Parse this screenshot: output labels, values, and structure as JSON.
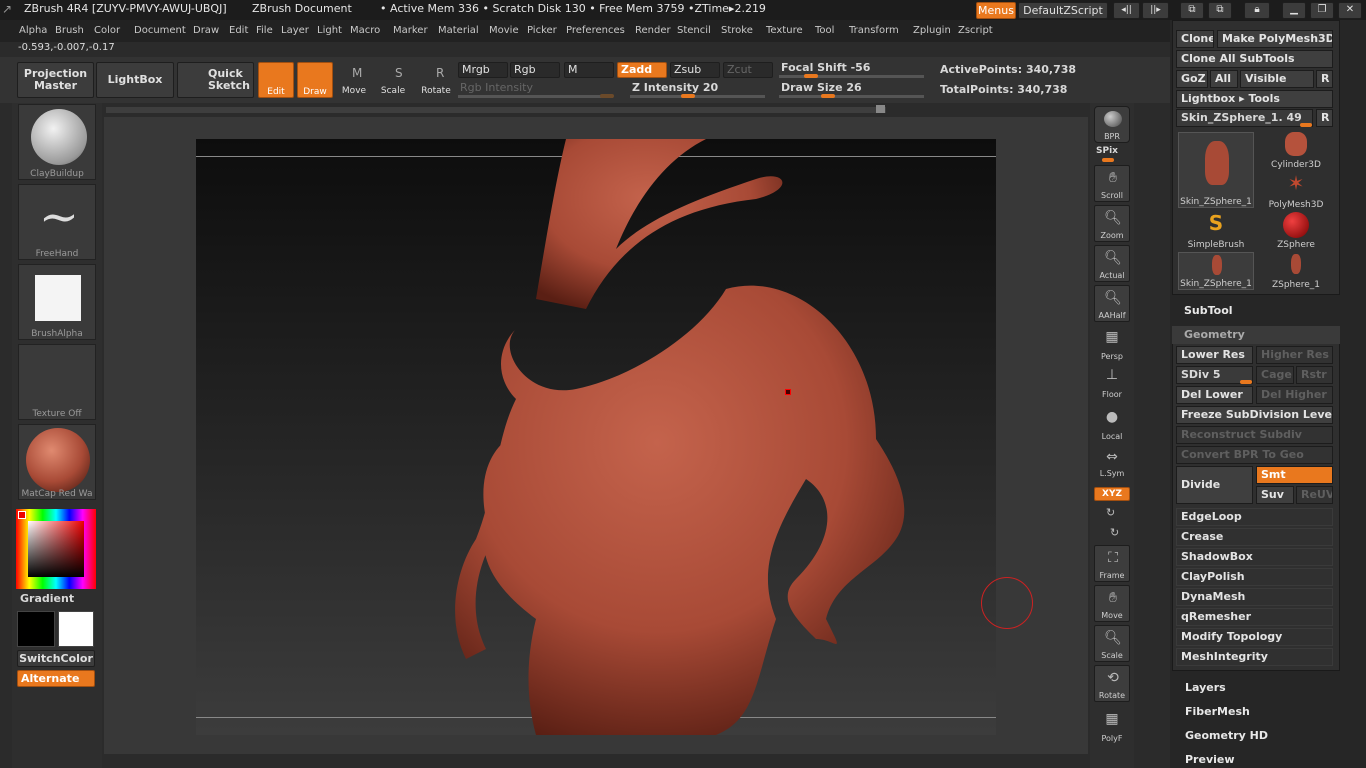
{
  "titlebar": {
    "app": "ZBrush 4R4 [ZUYV-PMVY-AWUJ-UBQJ]",
    "document": "ZBrush Document",
    "stats": "• Active Mem 336 • Scratch Disk 130 • Free Mem 3759 •ZTime▸2.219",
    "menus_btn": "Menus",
    "script_btn": "DefaultZScript"
  },
  "menubar": [
    "Alpha",
    "Brush",
    "Color",
    "Document",
    "Draw",
    "Edit",
    "File",
    "Layer",
    "Light",
    "Macro",
    "Marker",
    "Material",
    "Movie",
    "Picker",
    "Preferences",
    "Render",
    "Stencil",
    "Stroke",
    "Texture",
    "Tool",
    "Transform",
    "Zplugin",
    "Zscript"
  ],
  "coords": "-0.593,-0.007,-0.17",
  "toolbar": {
    "projection_master": "Projection Master",
    "lightbox": "LightBox",
    "quick_sketch": "Quick Sketch",
    "edit": "Edit",
    "draw": "Draw",
    "move": "Move",
    "scale": "Scale",
    "rotate": "Rotate",
    "mrgb": "Mrgb",
    "rgb": "Rgb",
    "m": "M",
    "zadd": "Zadd",
    "zsub": "Zsub",
    "zcut": "Zcut",
    "rgb_intensity": "Rgb Intensity",
    "z_intensity": "Z Intensity 20",
    "focal_shift": "Focal Shift -56",
    "draw_size": "Draw Size 26",
    "active_points": "ActivePoints: 340,738",
    "total_points": "TotalPoints: 340,738"
  },
  "left": {
    "brush": "ClayBuildup",
    "stroke": "FreeHand",
    "alpha": "BrushAlpha",
    "texture": "Texture Off",
    "material": "MatCap Red Wa",
    "gradient": "Gradient",
    "switch_color": "SwitchColor",
    "alternate": "Alternate"
  },
  "right": {
    "bpr": "BPR",
    "spix": "SPix",
    "scroll": "Scroll",
    "zoom": "Zoom",
    "actual": "Actual",
    "aahalf": "AAHalf",
    "persp": "Persp",
    "floor": "Floor",
    "local": "Local",
    "lsym": "L.Sym",
    "xyz": "XYZ",
    "frame": "Frame",
    "move": "Move",
    "scale": "Scale",
    "rotate": "Rotate",
    "polyf": "PolyF"
  },
  "tray": {
    "clone": "Clone",
    "make_polymesh": "Make PolyMesh3D",
    "clone_all": "Clone All SubTools",
    "goz": "GoZ",
    "all": "All",
    "visible": "Visible",
    "r": "R",
    "lightbox_tools": "Lightbox ▸ Tools",
    "current_tool": "Skin_ZSphere_1. 49",
    "tools": [
      "Skin_ZSphere_1",
      "Cylinder3D",
      "PolyMesh3D",
      "SimpleBrush",
      "ZSphere",
      "Skin_ZSphere_1",
      "ZSphere_1"
    ],
    "subtool": "SubTool",
    "geometry": "Geometry",
    "lower_res": "Lower Res",
    "higher_res": "Higher Res",
    "sdiv": "SDiv 5",
    "cage": "Cage",
    "rstr": "Rstr",
    "del_lower": "Del Lower",
    "del_higher": "Del Higher",
    "freeze": "Freeze SubDivision Levels",
    "reconstruct": "Reconstruct Subdiv",
    "convert_bpr": "Convert BPR To Geo",
    "divide": "Divide",
    "smt": "Smt",
    "suv": "Suv",
    "reuv": "ReUV",
    "sections": [
      "EdgeLoop",
      "Crease",
      "ShadowBox",
      "ClayPolish",
      "DynaMesh",
      "qRemesher",
      "Modify Topology",
      "MeshIntegrity"
    ],
    "bottom_sections": [
      "Layers",
      "FiberMesh",
      "Geometry HD",
      "Preview"
    ]
  },
  "colors": {
    "accent": "#e9781e",
    "model": "#a84a36"
  }
}
